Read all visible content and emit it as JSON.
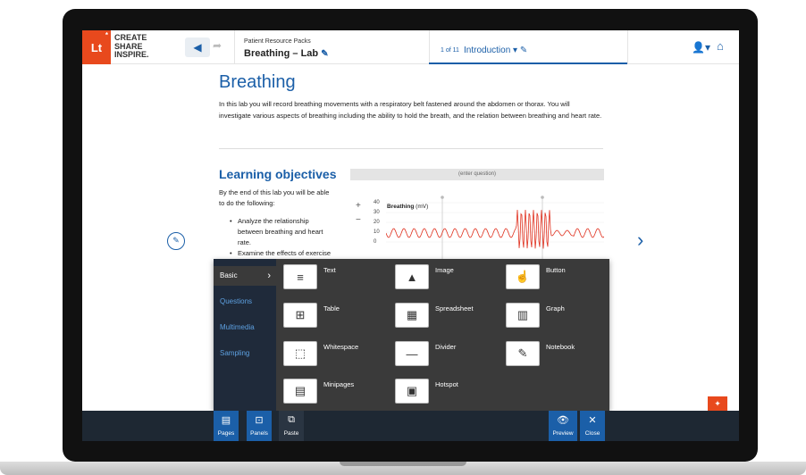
{
  "header": {
    "logo_text": "Lt",
    "logo_star": "*",
    "tagline": [
      "CREATE",
      "SHARE",
      "INSPIRE."
    ],
    "back_icon": "undo-arrow-icon",
    "forward_icon": "redo-arrow-icon",
    "pack_label": "Patient Resource Packs",
    "lesson_title": "Breathing – Lab",
    "page_counter": "1 of 11",
    "page_name": "Introduction ▾",
    "user_icon": "user-icon",
    "home_icon": "home-icon"
  },
  "page": {
    "title": "Breathing",
    "intro": "In this lab you will record breathing movements with a respiratory belt fastened around the abdomen or thorax. You will investigate various aspects of breathing including the ability to hold the breath, and the relation between breathing and heart rate.",
    "objectives_heading": "Learning objectives",
    "objectives_intro": "By the end of this lab you will be able to do the following:",
    "objectives": [
      "Analyze the relationship between breathing and heart rate.",
      "Examine the effects of exercise"
    ],
    "question_placeholder": "(enter question)"
  },
  "graph": {
    "channel": "Breathing",
    "unit": "(mV)",
    "y_ticks": [
      "40",
      "30",
      "20",
      "10",
      "0"
    ],
    "zoom_in": "+",
    "zoom_out": "−",
    "line_color": "#e0301e"
  },
  "panel": {
    "menu": [
      {
        "label": "Basic",
        "active": true
      },
      {
        "label": "Questions"
      },
      {
        "label": "Multimedia"
      },
      {
        "label": "Sampling"
      }
    ],
    "tiles": [
      {
        "label": "Text",
        "icon": "text-icon"
      },
      {
        "label": "Image",
        "icon": "image-icon"
      },
      {
        "label": "Button",
        "icon": "button-icon"
      },
      {
        "label": "Table",
        "icon": "table-icon"
      },
      {
        "label": "Spreadsheet",
        "icon": "spreadsheet-icon"
      },
      {
        "label": "Graph",
        "icon": "graph-icon"
      },
      {
        "label": "Whitespace",
        "icon": "whitespace-icon"
      },
      {
        "label": "Divider",
        "icon": "divider-icon"
      },
      {
        "label": "Notebook",
        "icon": "notebook-icon"
      },
      {
        "label": "Minipages",
        "icon": "minipages-icon"
      },
      {
        "label": "Hotspot",
        "icon": "hotspot-icon"
      }
    ]
  },
  "toolbar": {
    "pages": "Pages",
    "panels": "Panels",
    "paste": "Paste",
    "preview": "Preview",
    "close": "Close"
  },
  "colors": {
    "brand_blue": "#1b5fa8",
    "brand_orange": "#e8491d"
  }
}
